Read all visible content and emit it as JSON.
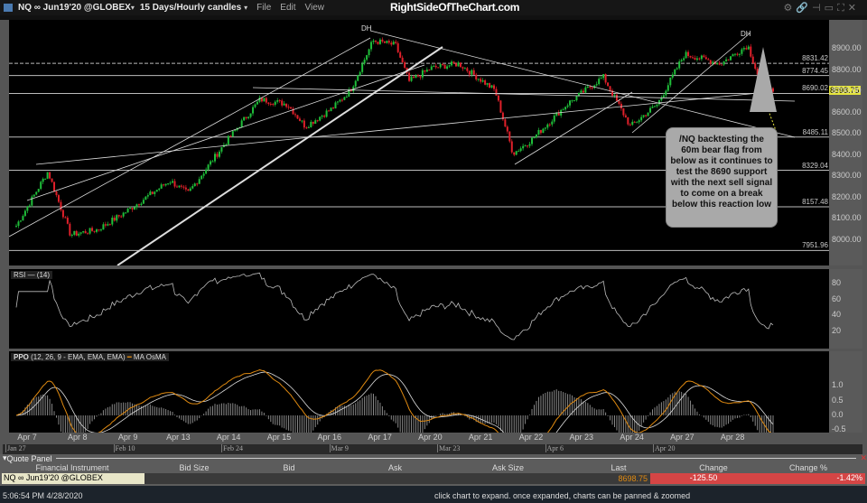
{
  "window": {
    "symbol": "NQ ∞ Jun19'20 @GLOBEX",
    "timeframe": "15 Days/Hourly candles",
    "menu": [
      "File",
      "Edit",
      "View"
    ],
    "brand": "RightSideOfTheChart.com"
  },
  "chart_data": [
    {
      "type": "candlestick",
      "title": "NQ ∞ Jun19'20 @GLOBEX",
      "ylim": [
        7930,
        9000
      ],
      "y_ticks": [
        "8900.00",
        "8800.00",
        "8700.00",
        "8600.00",
        "8500.00",
        "8400.00",
        "8300.00",
        "8200.00",
        "8100.00",
        "8000.00"
      ],
      "x_ticks": [
        "Apr 7",
        "Apr 8",
        "Apr 9",
        "Apr 13",
        "Apr 14",
        "Apr 15",
        "Apr 16",
        "Apr 17",
        "Apr 20",
        "Apr 21",
        "Apr 22",
        "Apr 23",
        "Apr 24",
        "Apr 27",
        "Apr 28"
      ],
      "approx_close_path": [
        [
          "Apr 6",
          8068
        ],
        [
          "Apr 7",
          8323
        ],
        [
          "Apr 7",
          8026
        ],
        [
          "Apr 8",
          8050
        ],
        [
          "Apr 9",
          8130
        ],
        [
          "Apr 13",
          8280
        ],
        [
          "Apr 13",
          8220
        ],
        [
          "Apr 14",
          8450
        ],
        [
          "Apr 15",
          8662
        ],
        [
          "Apr 15",
          8640
        ],
        [
          "Apr 16",
          8535
        ],
        [
          "Apr 16",
          8620
        ],
        [
          "Apr 16",
          8705
        ],
        [
          "Apr 17",
          8938
        ],
        [
          "Apr 17",
          8917
        ],
        [
          "Apr 17",
          8747
        ],
        [
          "Apr 20",
          8810
        ],
        [
          "Apr 20",
          8830
        ],
        [
          "Apr 21",
          8705
        ],
        [
          "Apr 21",
          8408
        ],
        [
          "Apr 22",
          8470
        ],
        [
          "Apr 22",
          8640
        ],
        [
          "Apr 23",
          8768
        ],
        [
          "Apr 24",
          8535
        ],
        [
          "Apr 24",
          8640
        ],
        [
          "Apr 27",
          8875
        ],
        [
          "Apr 27",
          8830
        ],
        [
          "Apr 28",
          8917
        ],
        [
          "Apr 28",
          8726
        ],
        [
          "Apr 28",
          8698.75
        ]
      ],
      "last_price": "8698.75",
      "levels": [
        "8831.42",
        "8774.45",
        "8690.02",
        "8485.11",
        "8329.04",
        "8157.48",
        "7951.96"
      ],
      "annotations": [
        "DH",
        "DH"
      ],
      "callout": "/NQ backtesting the 60m bear flag from below as it continues to test the 8690 support with the next sell signal to come on a break below this reaction low",
      "colors": {
        "up": "#1fbf3a",
        "down": "#e0202a",
        "last": "#e6e63c"
      }
    },
    {
      "type": "line",
      "label": "RSI",
      "params": "(14)",
      "ylim": [
        0,
        100
      ],
      "y_ticks": [
        "80",
        "60",
        "40",
        "20"
      ]
    },
    {
      "type": "line",
      "label": "PPO",
      "params": "(12, 26, 9 - EMA, EMA, EMA)",
      "legend": [
        "MA",
        "OsMA"
      ],
      "ylim": [
        -0.8,
        1.2
      ],
      "y_ticks": [
        "1.0",
        "0.5",
        "0.0",
        "-0.5"
      ],
      "colors": {
        "ppo": "#e08a10",
        "ma": "#dddddd",
        "osma": "#888888"
      }
    }
  ],
  "navigator": [
    "Jan 27",
    "Feb 10",
    "Feb 24",
    "Mar 9",
    "Mar 23",
    "Apr 6",
    "Apr 20"
  ],
  "quote_panel": {
    "title": "Quote Panel",
    "columns": [
      "Financial Instrument",
      "Bid Size",
      "Bid",
      "Ask",
      "Ask Size",
      "Last",
      "Change",
      "Change %"
    ],
    "row": {
      "instrument": "NQ ∞ Jun19'20 @GLOBEX",
      "bid_size": "",
      "bid": "",
      "ask": "",
      "ask_size": "",
      "last": "8698.75",
      "change": "-125.50",
      "change_pct": "-1.42%"
    }
  },
  "status": {
    "time": "5:06:54 PM 4/28/2020",
    "hint": "click chart to expand. once expanded, charts can be panned & zoomed"
  }
}
